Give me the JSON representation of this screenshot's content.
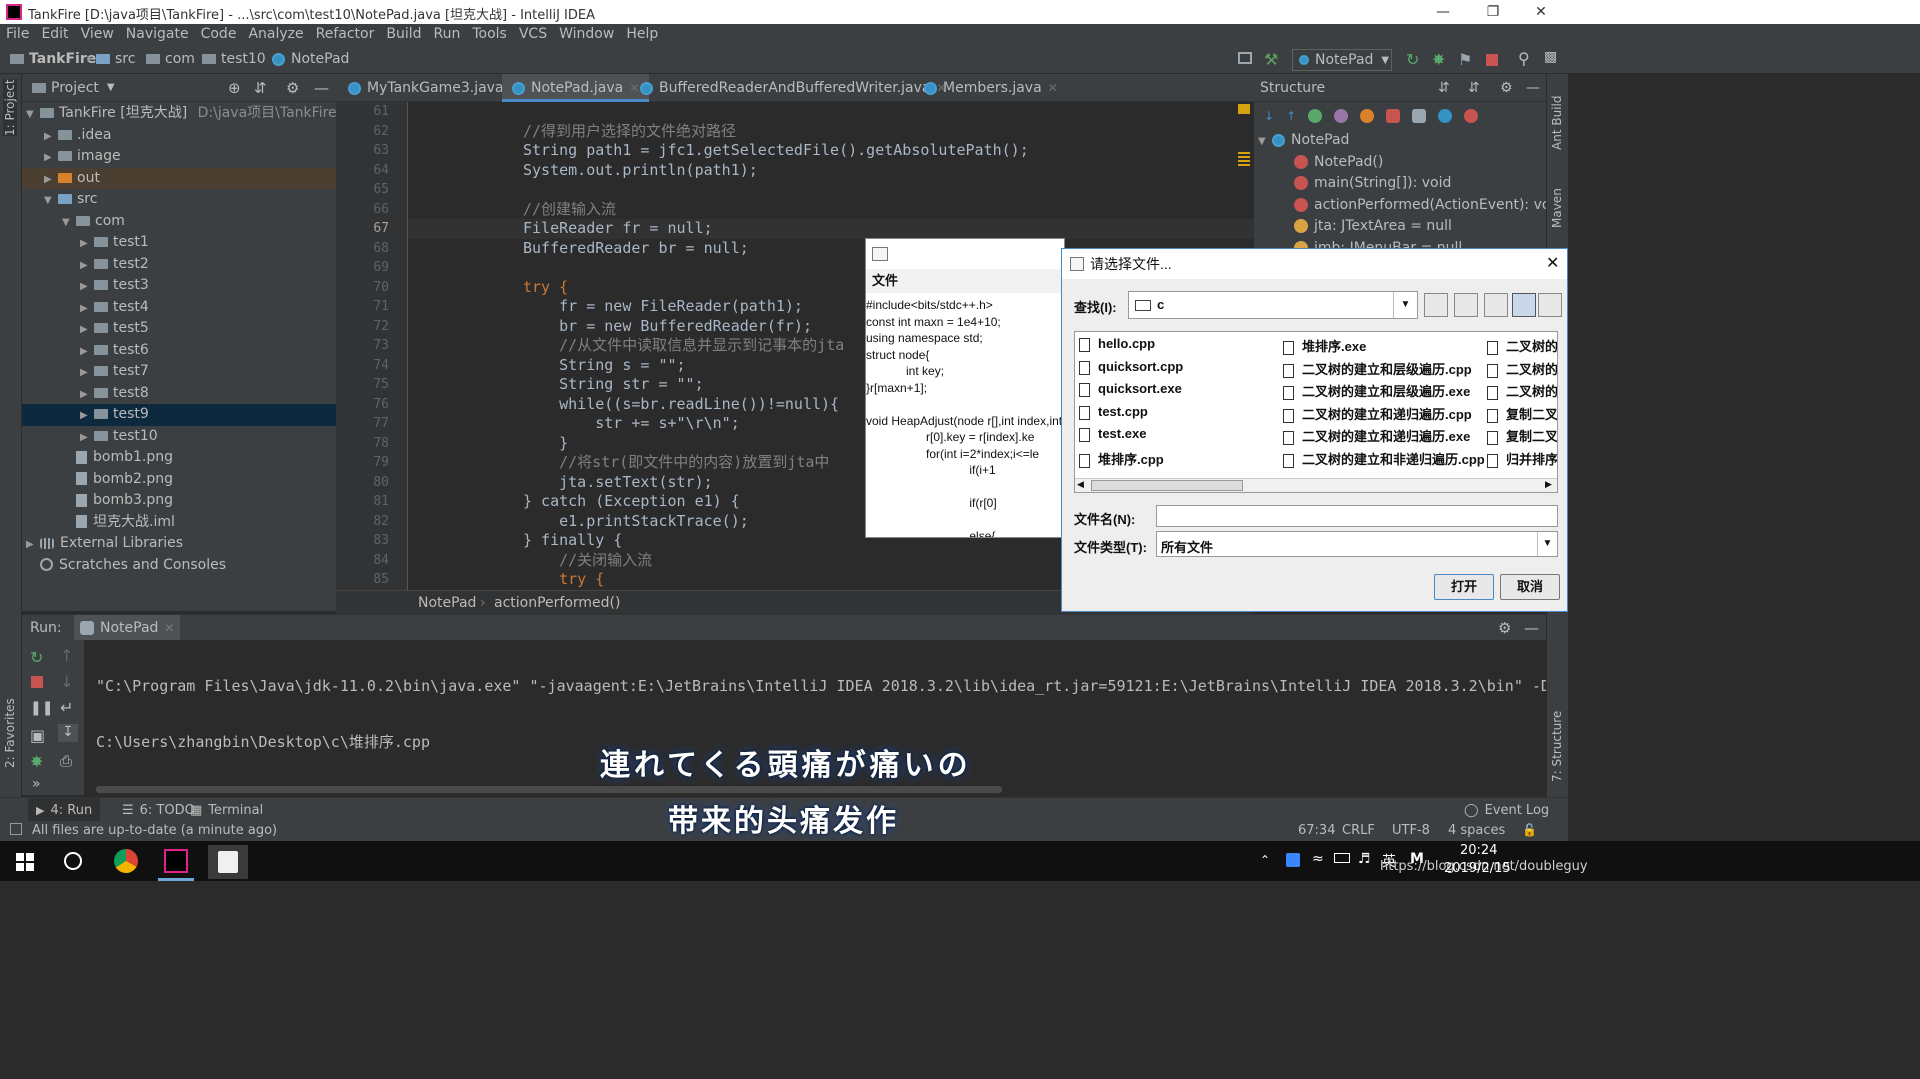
{
  "window": {
    "title": "TankFire [D:\\java项目\\TankFire] - ...\\src\\com\\test10\\NotePad.java [坦克大战] - IntelliJ IDEA"
  },
  "menu": [
    "File",
    "Edit",
    "View",
    "Navigate",
    "Code",
    "Analyze",
    "Refactor",
    "Build",
    "Run",
    "Tools",
    "VCS",
    "Window",
    "Help"
  ],
  "breadcrumb": [
    "TankFire",
    "src",
    "com",
    "test10",
    "NotePad"
  ],
  "run_config": "NotePad",
  "project": {
    "header": "Project",
    "root": "TankFire [坦克大战]",
    "root_path": "D:\\java项目\\TankFire",
    "items": [
      ".idea",
      "image",
      "out",
      "src",
      "com",
      "test1",
      "test2",
      "test3",
      "test4",
      "test5",
      "test6",
      "test7",
      "test8",
      "test9",
      "test10",
      "bomb1.png",
      "bomb2.png",
      "bomb3.png",
      "坦克大战.iml",
      "External Libraries",
      "Scratches and Consoles"
    ]
  },
  "side_tabs": {
    "project": "1: Project",
    "favorites": "2: Favorites",
    "structure": "7: Structure",
    "ant": "Ant Build",
    "maven": "Maven"
  },
  "tabs": [
    "MyTankGame3.java",
    "NotePad.java",
    "BufferedReaderAndBufferedWriter.java",
    "Members.java"
  ],
  "code": {
    "line_numbers": [
      "61",
      "62",
      "63",
      "64",
      "65",
      "66",
      "67",
      "68",
      "69",
      "70",
      "71",
      "72",
      "73",
      "74",
      "75",
      "76",
      "77",
      "78",
      "79",
      "80",
      "81",
      "82",
      "83",
      "84",
      "85"
    ],
    "lines": [
      "",
      "//得到用户选择的文件绝对路径",
      "String path1 = jfc1.getSelectedFile().getAbsolutePath();",
      "System.out.println(path1);",
      "",
      "//创建输入流",
      "FileReader fr = null;",
      "BufferedReader br = null;",
      "",
      "try {",
      "    fr = new FileReader(path1);",
      "    br = new BufferedReader(fr);",
      "    //从文件中读取信息并显示到记事本的jta",
      "    String s = \"\";",
      "    String str = \"\";",
      "    while((s=br.readLine())!=null){",
      "        str += s+\"\\r\\n\";",
      "    }",
      "    //将str(即文件中的内容)放置到jta中",
      "    jta.setText(str);",
      "} catch (Exception e1) {",
      "    e1.printStackTrace();",
      "} finally {",
      "    //关闭输入流",
      "    try {"
    ]
  },
  "editor_footer": [
    "NotePad",
    "actionPerformed()"
  ],
  "structure": {
    "header": "Structure",
    "root": "NotePad",
    "items": [
      "NotePad()",
      "main(String[]): void",
      "actionPerformed(ActionEvent): void",
      "jta: JTextArea = null",
      "jmb: JMenuBar = null"
    ]
  },
  "notepad_window": {
    "menu": "文件",
    "text": "#include<bits/stdc++.h>\nconst int maxn = 1e4+10;\nusing namespace std;\nstruct node{\n            int key;\n}r[maxn+1];\n\nvoid HeapAdjust(node r[],int index,int\n                  r[0].key = r[index].ke\n                  for(int i=2*index;i<=le\n                               if(i+1\n\n                               if(r[0]\n\n                               else{"
  },
  "file_dialog": {
    "title": "请选择文件...",
    "look_in_label": "查找(I):",
    "look_in_value": "c",
    "files_col1": [
      "hello.cpp",
      "quicksort.cpp",
      "quicksort.exe",
      "test.cpp",
      "test.exe",
      "堆排序.cpp"
    ],
    "files_col2": [
      "堆排序.exe",
      "二叉树的建立和层级遍历.cpp",
      "二叉树的建立和层级遍历.exe",
      "二叉树的建立和递归遍历.cpp",
      "二叉树的建立和递归遍历.exe",
      "二叉树的建立和非递归遍历.cpp"
    ],
    "files_col3": [
      "二叉树的",
      "二叉树的",
      "二叉树的",
      "复制二叉",
      "复制二叉",
      "归并排序."
    ],
    "filename_label": "文件名(N):",
    "filename_value": "",
    "filetype_label": "文件类型(T):",
    "filetype_value": "所有文件",
    "open_button": "打开",
    "cancel_button": "取消"
  },
  "run": {
    "label": "Run:",
    "tab": "NotePad",
    "output": [
      "\"C:\\Program Files\\Java\\jdk-11.0.2\\bin\\java.exe\" \"-javaagent:E:\\JetBrains\\IntelliJ IDEA 2018.3.2\\lib\\idea_rt.jar=59121:E:\\JetBrains\\IntelliJ IDEA 2018.3.2\\bin\" -D",
      "C:\\Users\\zhangbin\\Desktop\\c\\堆排序.cpp"
    ]
  },
  "bottom_tabs": [
    "4: Run",
    "6: TODO",
    "Terminal"
  ],
  "event_log": "Event Log",
  "status": {
    "message": "All files are up-to-date (a minute ago)",
    "position": "67:34",
    "line_sep": "CRLF",
    "encoding": "UTF-8",
    "indent": "4 spaces"
  },
  "subtitles": {
    "jp": "連れてくる頭痛が痛いの",
    "cn": "带来的头痛发作"
  },
  "taskbar": {
    "time": "20:24",
    "date": "2019/2/15",
    "lang": "英",
    "watermark": "https://blog.csdn.net/doubleguy"
  },
  "colors": {
    "accent": "#4a88c7",
    "keyword": "#cc7832",
    "comment": "#808080",
    "string": "#6a8759",
    "field": "#9876aa"
  }
}
